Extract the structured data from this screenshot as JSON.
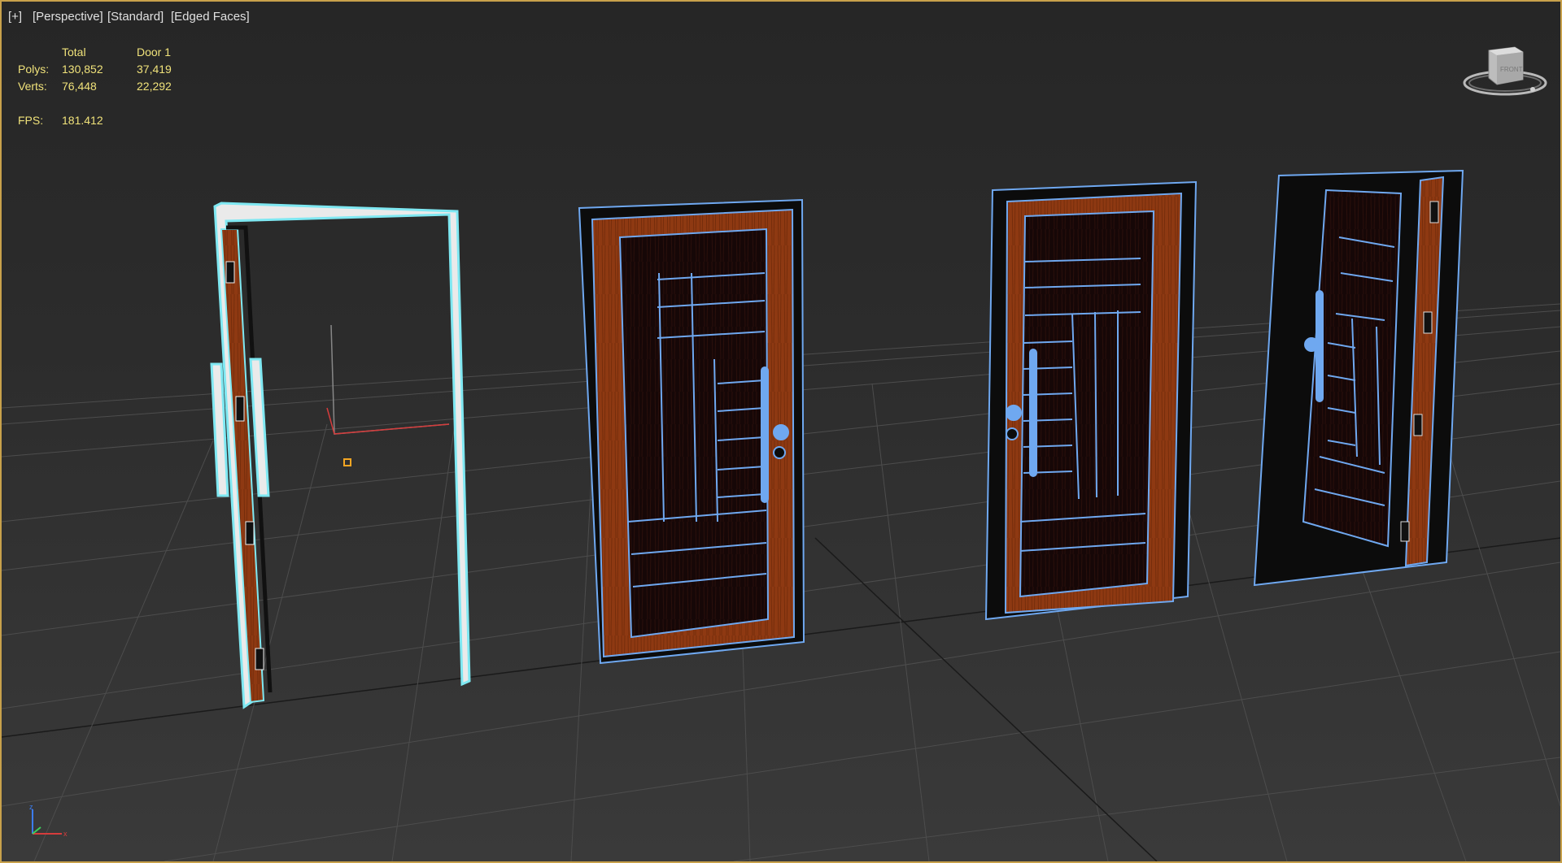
{
  "viewport": {
    "labels": {
      "plus": "[+]",
      "view": "[Perspective]",
      "shading": "[Standard]",
      "display": "[Edged Faces]"
    },
    "stats": {
      "headers": {
        "total": "Total",
        "selected": "Door 1"
      },
      "polys": {
        "label": "Polys:",
        "total": "130,852",
        "selected": "37,419"
      },
      "verts": {
        "label": "Verts:",
        "total": "76,448",
        "selected": "22,292"
      },
      "fps": {
        "label": "FPS:",
        "value": "181.412"
      }
    },
    "viewcube": {
      "face": "FRONT",
      "icon": "viewcube-icon"
    },
    "axes": {
      "x": "x",
      "y": "y",
      "z": "z"
    },
    "objects": [
      "Door 1 frame (selected)",
      "door 2",
      "door 3",
      "door 4 open"
    ],
    "colors": {
      "selection": "#7fe8f2",
      "wire": "#6fa8f0",
      "wood": "#8e3912",
      "panel": "#140606",
      "frame_border": "#c8a14b"
    }
  }
}
